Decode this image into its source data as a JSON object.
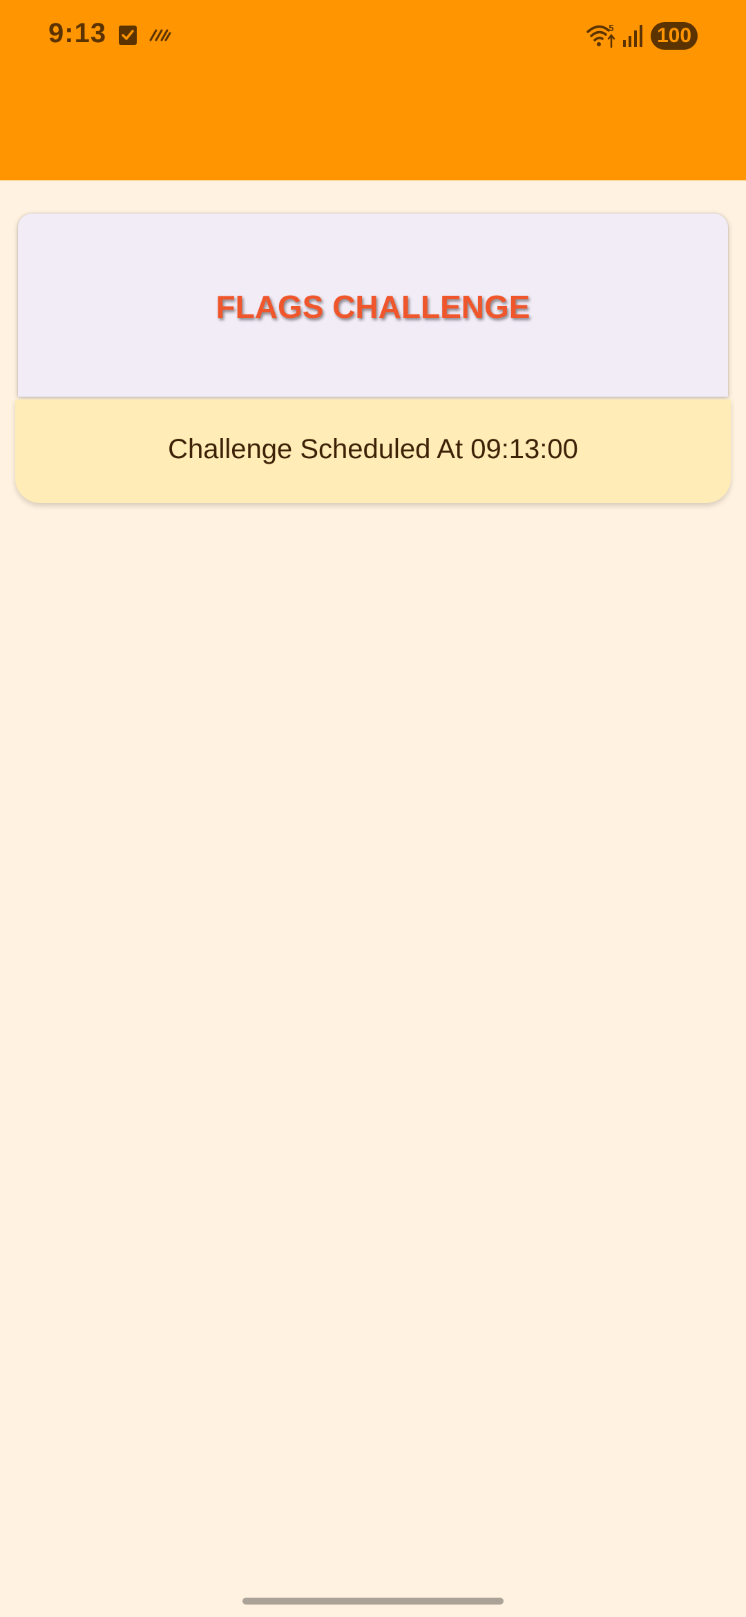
{
  "status_bar": {
    "time": "9:13",
    "battery": "100",
    "icons": [
      "task-done-icon",
      "silent-mode-icon",
      "wifi-icon",
      "signal-icon"
    ],
    "wifi_badge": "5"
  },
  "card": {
    "title": "FLAGS CHALLENGE"
  },
  "schedule": {
    "text": "Challenge Scheduled At 09:13:00"
  },
  "colors": {
    "app_bar": "#FF9500",
    "background": "#FFF2E0",
    "title": "#F0562B",
    "schedule_bg": "#FFECB6"
  }
}
